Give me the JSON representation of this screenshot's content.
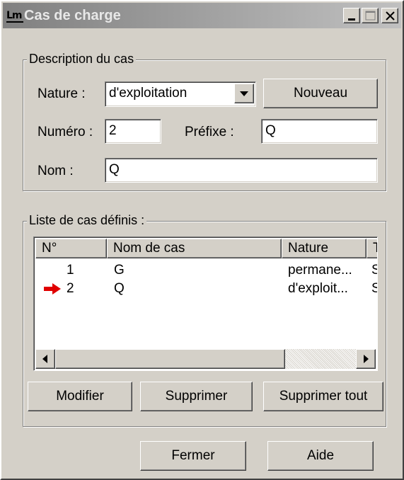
{
  "window": {
    "title": "Cas de charge",
    "icon_text": "Lm",
    "controls": {
      "minimize_icon": "minimize-icon",
      "maximize_icon": "maximize-icon",
      "close_icon": "close-icon"
    }
  },
  "description": {
    "legend": "Description du cas",
    "nature_label": "Nature :",
    "nature_value": "d'exploitation",
    "new_button": "Nouveau",
    "number_label": "Numéro :",
    "number_value": "2",
    "prefix_label": "Préfixe :",
    "prefix_value": "Q",
    "name_label": "Nom :",
    "name_value": "Q"
  },
  "list": {
    "legend": "Liste de cas définis :",
    "columns": [
      "N°",
      "Nom de cas",
      "Nature",
      "T"
    ],
    "rows": [
      {
        "num": "1",
        "name": "G",
        "nature": "permane...",
        "t": "S",
        "current": false
      },
      {
        "num": "2",
        "name": "Q",
        "nature": "d'exploit...",
        "t": "S",
        "current": true
      }
    ],
    "current_marker_color": "#e00000"
  },
  "actions": {
    "modify": "Modifier",
    "delete": "Supprimer",
    "delete_all": "Supprimer tout"
  },
  "footer": {
    "close": "Fermer",
    "help": "Aide"
  },
  "colors": {
    "face": "#d4d0c8",
    "title_gradient_start": "#808080",
    "title_gradient_end": "#c0c0c0",
    "arrow": "#e00000"
  }
}
